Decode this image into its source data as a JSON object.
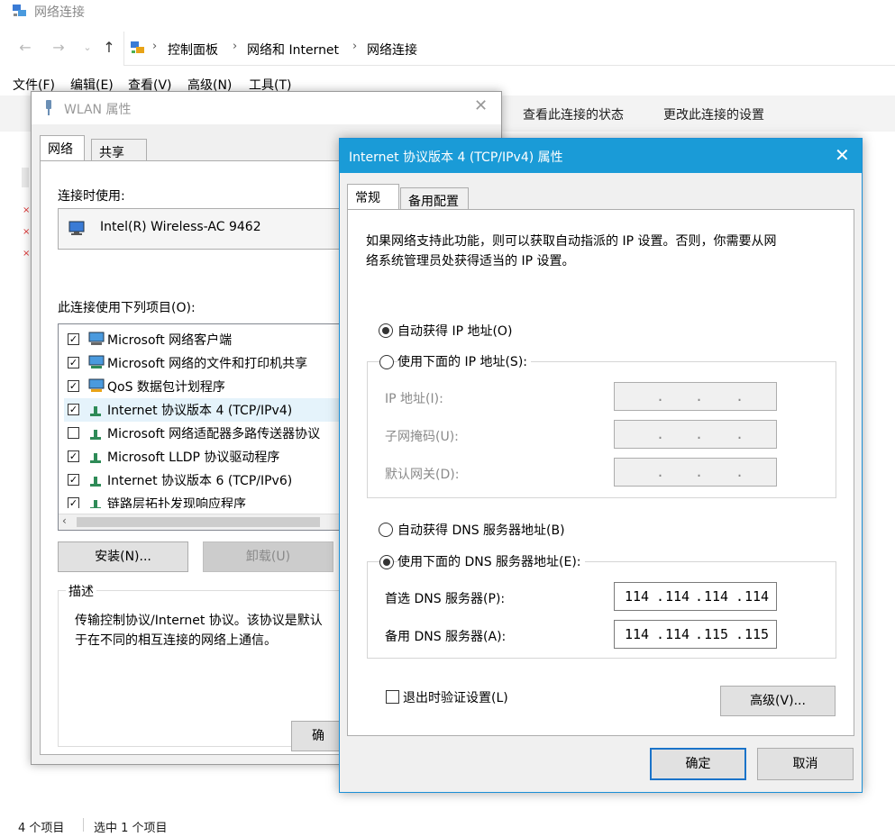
{
  "explorer": {
    "title": "网络连接",
    "breadcrumb": [
      "控制面板",
      "网络和 Internet",
      "网络连接"
    ],
    "menu": [
      "文件(F)",
      "编辑(E)",
      "查看(V)",
      "高级(N)",
      "工具(T)"
    ],
    "commands": [
      "查看此连接的状态",
      "更改此连接的设置"
    ],
    "status_count": "4 个项目",
    "status_selected": "选中 1 个项目"
  },
  "wlan": {
    "title": "WLAN 属性",
    "tabs": [
      "网络",
      "共享"
    ],
    "connect_using_label": "连接时使用:",
    "adapter_name": "Intel(R) Wireless-AC 9462",
    "items_label": "此连接使用下列项目(O):",
    "items": [
      {
        "label": "Microsoft 网络客户端",
        "checked": true,
        "icon": "network-client-icon"
      },
      {
        "label": "Microsoft 网络的文件和打印机共享",
        "checked": true,
        "icon": "file-sharing-icon"
      },
      {
        "label": "QoS 数据包计划程序",
        "checked": true,
        "icon": "qos-icon"
      },
      {
        "label": "Internet 协议版本 4 (TCP/IPv4)",
        "checked": true,
        "icon": "protocol-icon"
      },
      {
        "label": "Microsoft 网络适配器多路传送器协议",
        "checked": false,
        "icon": "protocol-icon"
      },
      {
        "label": "Microsoft LLDP 协议驱动程序",
        "checked": true,
        "icon": "protocol-icon"
      },
      {
        "label": "Internet 协议版本 6 (TCP/IPv6)",
        "checked": true,
        "icon": "protocol-icon"
      },
      {
        "label": "链路层拓扑发现响应程序",
        "checked": true,
        "icon": "protocol-icon"
      }
    ],
    "install_label": "安装(N)...",
    "uninstall_label": "卸载(U)",
    "description_title": "描述",
    "description_line1": "传输控制协议/Internet 协议。该协议是默认",
    "description_line2": "于在不同的相互连接的网络上通信。",
    "ok_label_partial": "确"
  },
  "ipv4": {
    "title": "Internet 协议版本 4 (TCP/IPv4) 属性",
    "tabs": [
      "常规",
      "备用配置"
    ],
    "intro_line1": "如果网络支持此功能，则可以获取自动指派的 IP 设置。否则，你需要从网",
    "intro_line2": "络系统管理员处获得适当的 IP 设置。",
    "auto_ip_label": "自动获得 IP 地址(O)",
    "manual_ip_label": "使用下面的 IP 地址(S):",
    "ip_address_label": "IP 地址(I):",
    "subnet_label": "子网掩码(U):",
    "gateway_label": "默认网关(D):",
    "auto_dns_label": "自动获得 DNS 服务器地址(B)",
    "manual_dns_label": "使用下面的 DNS 服务器地址(E):",
    "preferred_dns_label": "首选 DNS 服务器(P):",
    "alternate_dns_label": "备用 DNS 服务器(A):",
    "preferred_dns": [
      "114",
      "114",
      "114",
      "114"
    ],
    "alternate_dns": [
      "114",
      "114",
      "115",
      "115"
    ],
    "validate_label": "退出时验证设置(L)",
    "advanced_label": "高级(V)...",
    "ok_label": "确定",
    "cancel_label": "取消",
    "auto_ip_selected": true,
    "manual_dns_selected": true
  },
  "colors": {
    "accent": "#1a9bd7",
    "dialog_bg": "#f0f0f0",
    "disabled_text": "#8a8a8a"
  }
}
